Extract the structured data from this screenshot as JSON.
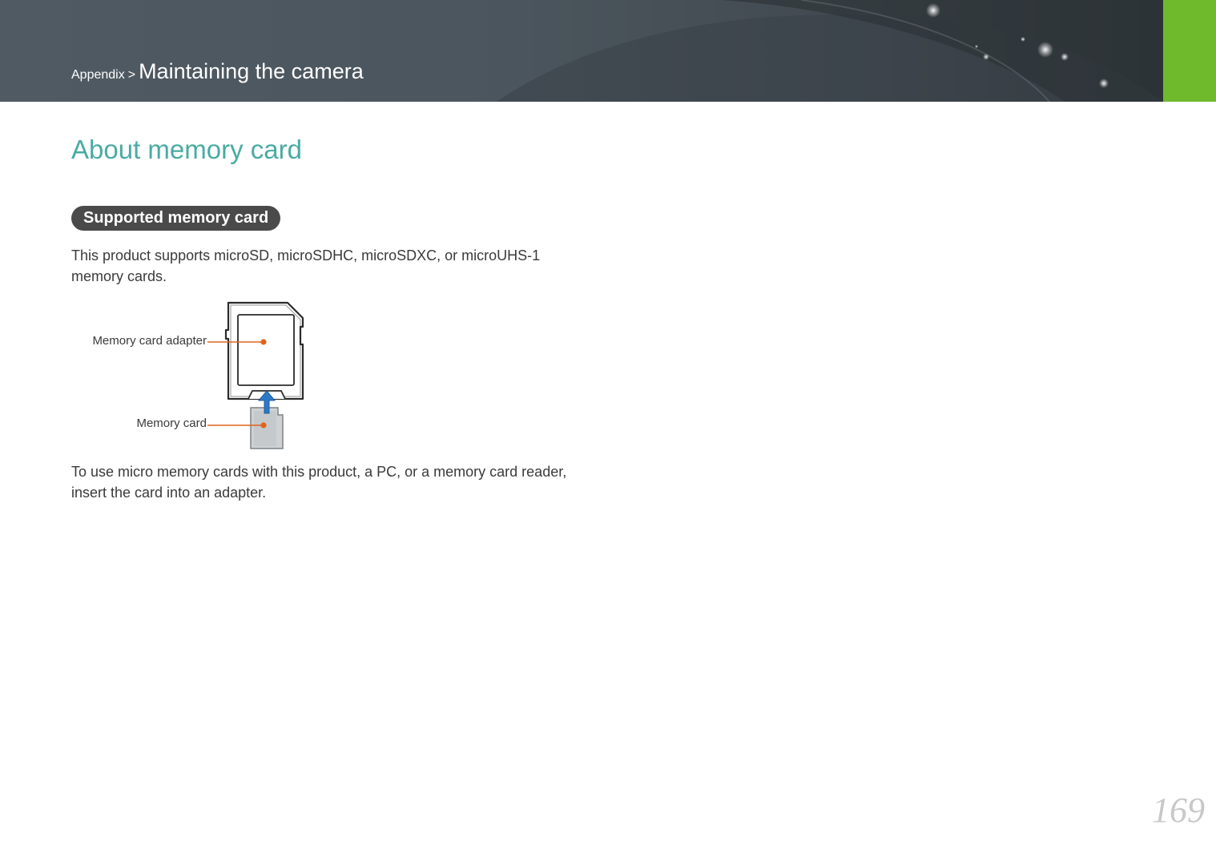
{
  "header": {
    "breadcrumb_parent": "Appendix",
    "breadcrumb_separator": ">",
    "breadcrumb_current": "Maintaining the camera",
    "accent_color": "#6fba2c"
  },
  "page_title": "About memory card",
  "section": {
    "title": "Supported memory card",
    "intro": "This product supports microSD, microSDHC, microSDXC, or microUHS-1 memory cards.",
    "figure": {
      "adapter_label": "Memory card adapter",
      "card_label": "Memory card",
      "callout_color": "#e2631c",
      "arrow_color": "#2d79c6"
    },
    "instructions": "To use micro memory cards with this product, a PC, or a memory card reader, insert the card into an adapter."
  },
  "page_number": "169"
}
